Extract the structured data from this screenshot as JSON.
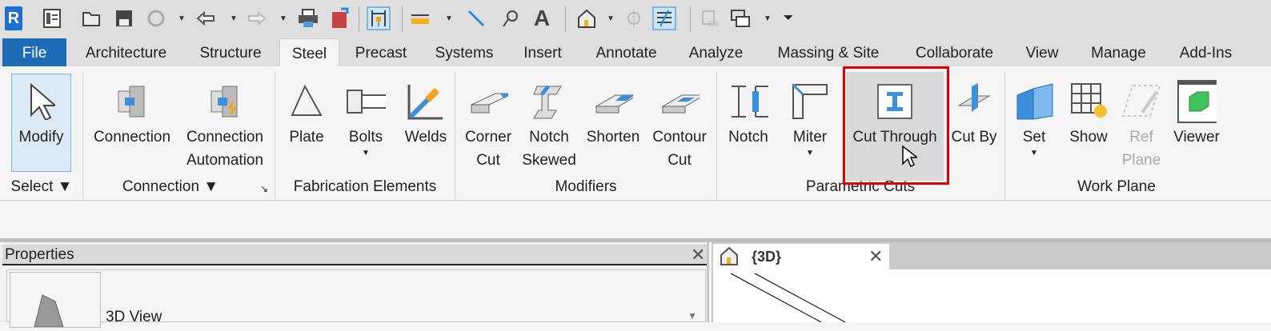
{
  "quick_access": {
    "icons": [
      "revit-logo-icon",
      "app-menu-icon",
      "open-icon",
      "save-icon",
      "sync-icon",
      "undo-icon",
      "redo-icon",
      "print-icon",
      "export-icon",
      "measure-pin-icon",
      "dimension-icon",
      "aligned-dimension-icon",
      "tag-icon",
      "text-icon",
      "default-3d-view-icon",
      "section-icon",
      "thin-lines-icon",
      "close-hidden-windows-icon",
      "switch-windows-icon",
      "customize-qat-icon"
    ],
    "logo_text": "R"
  },
  "tabs": [
    {
      "label": "File"
    },
    {
      "label": "Architecture"
    },
    {
      "label": "Structure"
    },
    {
      "label": "Steel",
      "active": true
    },
    {
      "label": "Precast"
    },
    {
      "label": "Systems"
    },
    {
      "label": "Insert"
    },
    {
      "label": "Annotate"
    },
    {
      "label": "Analyze"
    },
    {
      "label": "Massing & Site"
    },
    {
      "label": "Collaborate"
    },
    {
      "label": "View"
    },
    {
      "label": "Manage"
    },
    {
      "label": "Add-Ins"
    }
  ],
  "ribbon": {
    "buttons": {
      "modify": "Modify",
      "connection": "Connection",
      "connection_auto_1": "Connection",
      "connection_auto_2": "Automation",
      "plate": "Plate",
      "bolts": "Bolts",
      "welds": "Welds",
      "corner_cut_1": "Corner",
      "corner_cut_2": "Cut",
      "notch_skewed_1": "Notch",
      "notch_skewed_2": "Skewed",
      "shorten": "Shorten",
      "contour_cut_1": "Contour",
      "contour_cut_2": "Cut",
      "notch": "Notch",
      "miter": "Miter",
      "cut_through": "Cut Through",
      "cut_by": "Cut By",
      "set": "Set",
      "show": "Show",
      "ref_plane_1": "Ref",
      "ref_plane_2": "Plane",
      "viewer": "Viewer"
    },
    "panels": {
      "select": "Select",
      "connection": "Connection",
      "fabrication": "Fabrication Elements",
      "modifiers": "Modifiers",
      "parametric_cuts": "Parametric Cuts",
      "work_plane": "Work Plane"
    }
  },
  "properties": {
    "title": "Properties",
    "type_name": "3D View"
  },
  "view_tab": {
    "label": "{3D}"
  },
  "colors": {
    "highlight_box": "#e00000",
    "file_tab": "#1e6bb8"
  }
}
